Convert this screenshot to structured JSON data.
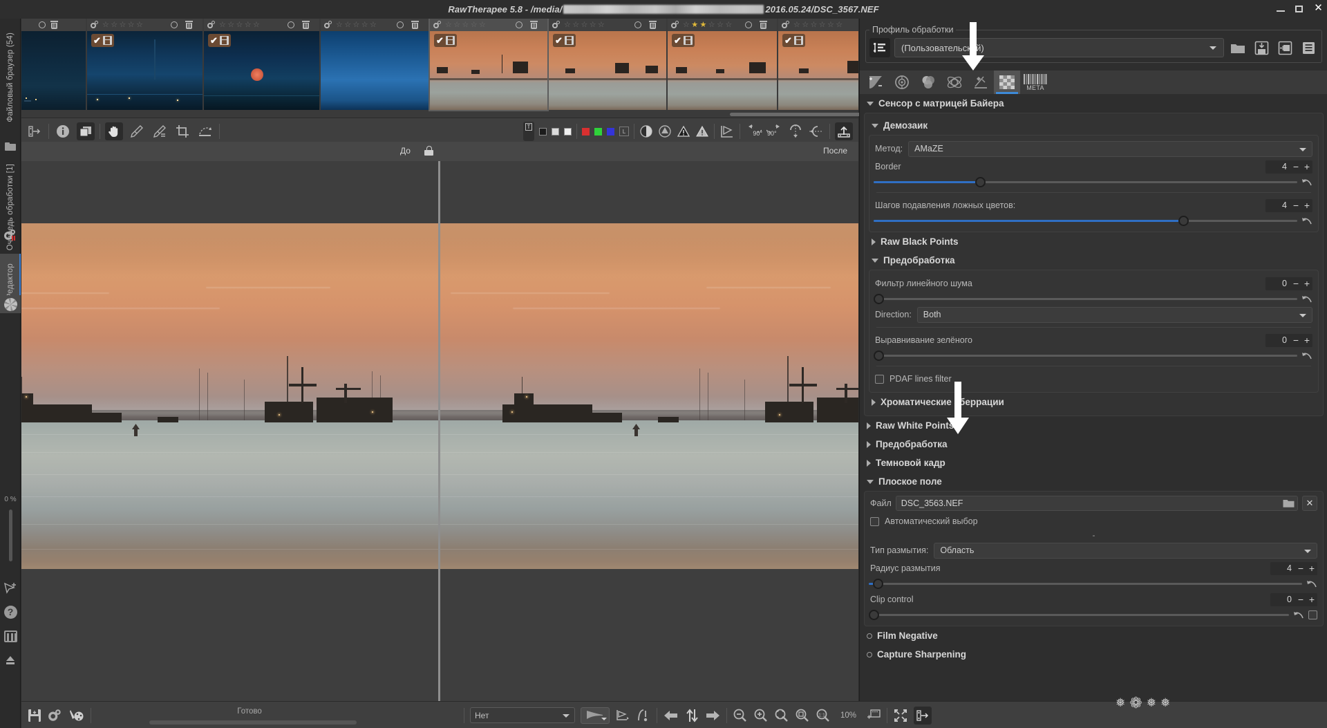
{
  "window": {
    "title_prefix": "RawTherapee 5.8 - /media/",
    "title_suffix": "2016.05.24/DSC_3567.NEF",
    "buttons": {
      "minimize": "minimize-window",
      "maximize": "maximize-window",
      "close": "✕"
    }
  },
  "left_rail": {
    "tabs": [
      {
        "label": "Файловый браузер (54)",
        "icon": "folder-icon",
        "selected": false
      },
      {
        "label": "Очередь обработки [1]",
        "icon": "gears-icon",
        "selected": false
      },
      {
        "label": "Редактор",
        "icon": "aperture-icon",
        "selected": true
      }
    ],
    "progress_label": "0 %",
    "bottom_icons": [
      "cursor-add-icon",
      "help-icon",
      "preferences-icon",
      "exit-icon"
    ]
  },
  "filmstrip": {
    "thumbnails": [
      {
        "rating": 0,
        "checked": false,
        "selected": false,
        "tone": "night-blue"
      },
      {
        "rating": 0,
        "checked": true,
        "selected": false,
        "tone": "night-blue-tower"
      },
      {
        "rating": 0,
        "checked": true,
        "selected": false,
        "tone": "night-moon"
      },
      {
        "rating": 0,
        "checked": false,
        "selected": false,
        "tone": "blue-gradient"
      },
      {
        "rating": 0,
        "checked": true,
        "selected": true,
        "tone": "sunset"
      },
      {
        "rating": 0,
        "checked": true,
        "selected": false,
        "tone": "sunset"
      },
      {
        "rating": 2,
        "checked": true,
        "selected": false,
        "tone": "sunset"
      },
      {
        "rating": 0,
        "checked": true,
        "selected": false,
        "tone": "sunset"
      }
    ]
  },
  "editor_toolbar": {
    "left_buttons": [
      "show-hide-left-panel-icon",
      "file-info-icon",
      "before-after-icon",
      "hand-tool-icon",
      "white-balance-picker-icon",
      "spot-wb-picker-icon",
      "crop-icon",
      "straighten-icon"
    ],
    "indicator_label": "T",
    "mono_swatches": [
      "#1c1c1c",
      "#dcdcdc",
      "#f0f0f0"
    ],
    "color_swatches": [
      "#d83030",
      "#2fd23a",
      "#3434d8"
    ],
    "lab_label": "L",
    "right_buttons": [
      "clipping-indicator-icon",
      "gamut-warning-icon",
      "shadow-clip-icon",
      "highlight-clip-icon",
      "perspective-icon",
      "rotate-left-90-icon",
      "rotate-right-90-icon",
      "flip-vertical-icon",
      "flip-horizontal-icon",
      "show-hide-right-panel-icon"
    ],
    "rotate_left_label": "90°",
    "rotate_right_label": "90°"
  },
  "before_after": {
    "before_label": "До",
    "after_label": "После",
    "lock_icon": "lock-icon"
  },
  "bottom_bar": {
    "icons": [
      "save-icon",
      "queue-icon",
      "send-to-editor-icon"
    ],
    "status_text": "Готово",
    "preview_mode": "Нет",
    "zoom_label": "10%",
    "buttons": [
      "histogram-mode-icon",
      "curve-editor-icon",
      "navigator-icon",
      "previous-image-icon",
      "sync-icon",
      "next-image-icon",
      "zoom-out-icon",
      "zoom-in-icon",
      "zoom-fit-icon",
      "zoom-crop-icon",
      "zoom-100-icon",
      "detail-window-icon",
      "fullscreen-icon",
      "hide-panels-icon"
    ]
  },
  "right_panel": {
    "profile_legend": "Профиль обработки",
    "profile_value": "(Пользовательский)",
    "profile_icons": [
      "profile-list-icon",
      "open-profile-icon",
      "save-profile-icon",
      "copy-profile-icon",
      "paste-profile-icon"
    ],
    "tool_tabs": [
      {
        "name": "exposure-tab",
        "label": "",
        "active": false
      },
      {
        "name": "detail-tab",
        "label": "",
        "active": false
      },
      {
        "name": "color-tab",
        "label": "",
        "active": false
      },
      {
        "name": "advanced-tab",
        "label": "",
        "active": false
      },
      {
        "name": "transform-tab",
        "label": "",
        "active": false
      },
      {
        "name": "raw-tab",
        "label": "",
        "active": true
      },
      {
        "name": "metadata-tab",
        "label": "META",
        "active": false
      }
    ],
    "sections": {
      "bayer": {
        "title": "Сенсор с матрицей Байера",
        "expanded": true
      },
      "demosaic": {
        "title": "Демозаик",
        "expanded": true,
        "method_label": "Метод:",
        "method_value": "AMaZE",
        "border_label": "Border",
        "border_value": "4",
        "border_slider_pct": 26,
        "false_color_label": "Шагов подавления ложных цветов:",
        "false_color_value": "4",
        "false_color_slider_pct": 74
      },
      "raw_black_points": {
        "title": "Raw Black Points",
        "expanded": false
      },
      "preprocessing": {
        "title": "Предобработка",
        "expanded": true,
        "line_noise_label": "Фильтр линейного шума",
        "line_noise_value": "0",
        "line_noise_slider_pct": 0,
        "direction_label": "Direction:",
        "direction_value": "Both",
        "green_equil_label": "Выравнивание зелёного",
        "green_equil_value": "0",
        "green_equil_slider_pct": 0,
        "pdaf_label": "PDAF lines filter",
        "pdaf_checked": false
      },
      "chromatic_aberration": {
        "title": "Хроматические аберрации",
        "expanded": false
      },
      "raw_white_points": {
        "title": "Raw White Points",
        "expanded": false
      },
      "preprocessing2": {
        "title": "Предобработка",
        "expanded": false
      },
      "dark_frame": {
        "title": "Темновой кадр",
        "expanded": false
      },
      "flat_field": {
        "title": "Плоское поле",
        "expanded": true,
        "file_label": "Файл",
        "file_value": "DSC_3563.NEF",
        "auto_select_label": "Автоматический выбор",
        "auto_select_checked": false,
        "info_text": "-",
        "blur_type_label": "Тип размытия:",
        "blur_type_value": "Область",
        "blur_radius_label": "Радиус размытия",
        "blur_radius_value": "4",
        "blur_radius_slider_pct": 3,
        "clip_control_label": "Clip control",
        "clip_control_value": "0",
        "clip_control_slider_pct": 0
      },
      "film_negative": {
        "title": "Film Negative",
        "expanded": false
      },
      "capture_sharpening": {
        "title": "Capture Sharpening",
        "expanded": false
      }
    }
  },
  "annotations": {
    "arrow_top": "white-down-arrow-pointing-to-raw-tab",
    "arrow_bottom": "white-down-arrow-pointing-to-flat-field-file"
  },
  "colors": {
    "accent_blue": "#3e8ad8",
    "slider_blue": "#2f6fc4",
    "star_gold": "#e0b93a",
    "panel_bg": "#2e2e2e",
    "toolbar_bg": "#3f3f3f",
    "badge_brown": "#6b4a33"
  }
}
